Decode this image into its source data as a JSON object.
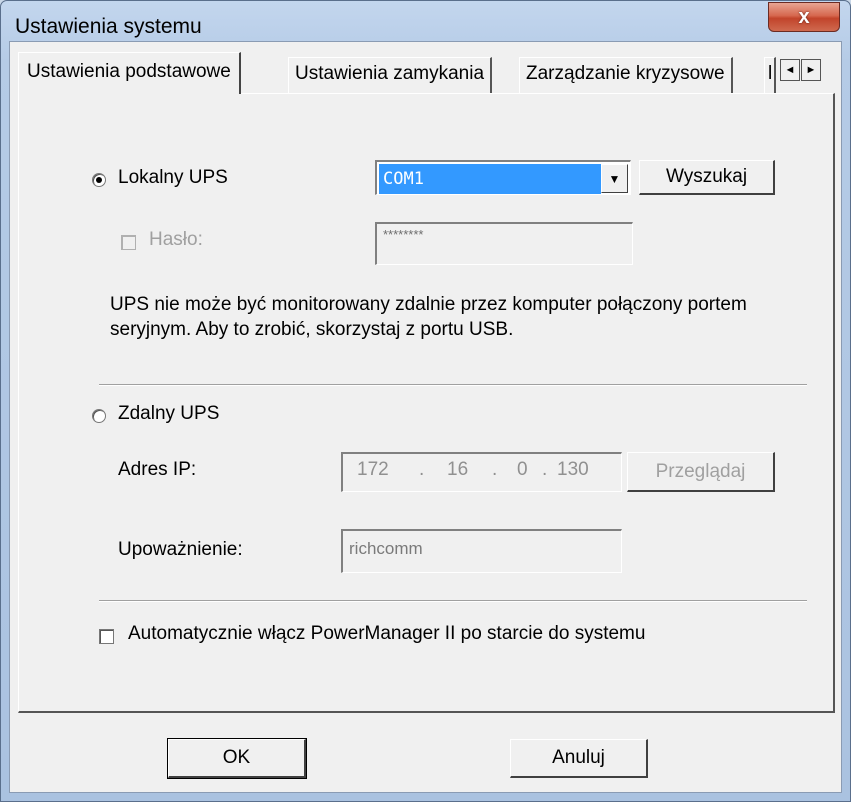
{
  "window": {
    "title": "Ustawienia systemu",
    "close_glyph": "x"
  },
  "tabs": [
    {
      "label": "Ustawienia podstawowe",
      "active": true
    },
    {
      "label": "Ustawienia zamykania",
      "active": false
    },
    {
      "label": "Zarządzanie kryzysowe",
      "active": false
    },
    {
      "label": "l",
      "active": false
    }
  ],
  "tab_scroll": {
    "left_glyph": "◄",
    "right_glyph": "►"
  },
  "local": {
    "radio_label": "Lokalny UPS",
    "selected": true,
    "port_value": "COM1",
    "dropdown_glyph": "▼",
    "search_button": "Wyszukaj",
    "password_label": "Hasło:",
    "password_checked": false,
    "password_value": "********",
    "note": "UPS nie może być monitorowany zdalnie przez komputer połączony portem seryjnym. Aby to zrobić, skorzystaj z portu USB."
  },
  "remote": {
    "radio_label": "Zdalny UPS",
    "selected": false,
    "ip_label": "Adres IP:",
    "ip_octets": [
      "172",
      "16",
      "0",
      "130"
    ],
    "ip_dot": ".",
    "browse_button": "Przeglądaj",
    "auth_label": "Upoważnienie:",
    "auth_value": "richcomm"
  },
  "autostart": {
    "label": "Automatycznie włącz PowerManager II po starcie do systemu",
    "checked": false
  },
  "footer": {
    "ok_label": "OK",
    "cancel_label": "Anuluj"
  },
  "colors": {
    "selection": "#3399ff",
    "close_button": "#c2442b",
    "dialog_bg": "#f0f0f0"
  },
  "icons": {
    "close": "close-icon",
    "dropdown": "chevron-down-icon",
    "tab_left": "arrow-left-icon",
    "tab_right": "arrow-right-icon"
  }
}
